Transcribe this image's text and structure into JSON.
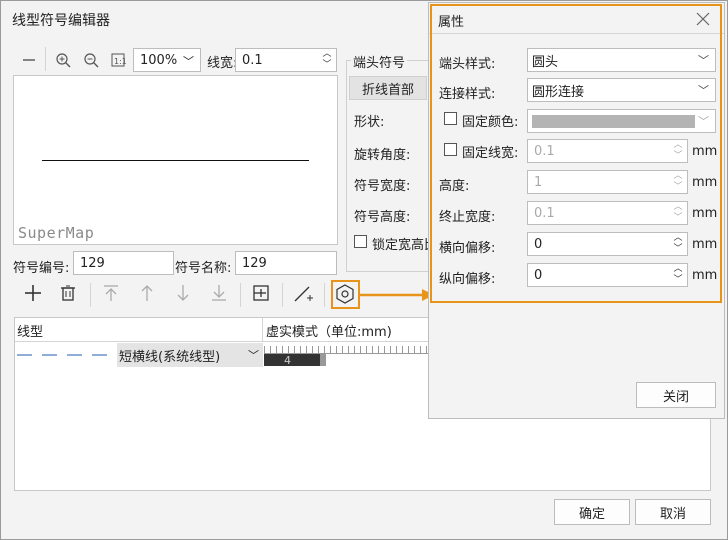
{
  "dialog": {
    "title": "线型符号编辑器",
    "toolbar": {
      "zoom_value": "100%",
      "line_width_label": "线宽:",
      "line_width_value": "0.1"
    },
    "preview_watermark": "SuperMap",
    "symbol_code_label": "符号编号:",
    "symbol_code_value": "129",
    "symbol_name_label": "符号名称:",
    "symbol_name_value": "129",
    "end_symbol_group": "端头符号",
    "end_symbol_tab": "折线首部",
    "shape_label": "形状:",
    "rotation_label": "旋转角度:",
    "symbol_width_label": "符号宽度:",
    "symbol_height_label": "符号高度:",
    "lock_ratio_label": "锁定宽高比",
    "table": {
      "col_linetype": "线型",
      "col_pattern": "虚实模式（单位:mm)",
      "row_linetype": "短横线(系统线型)",
      "row_pattern_value": "4"
    },
    "ok": "确定",
    "cancel": "取消"
  },
  "properties": {
    "title": "属性",
    "end_style_label": "端头样式:",
    "end_style_value": "圆头",
    "join_style_label": "连接样式:",
    "join_style_value": "圆形连接",
    "fixed_color_label": "固定颜色:",
    "fixed_width_label": "固定线宽:",
    "fixed_width_value": "0.1",
    "height_label": "高度:",
    "height_value": "1",
    "end_width_label": "终止宽度:",
    "end_width_value": "0.1",
    "h_offset_label": "横向偏移:",
    "h_offset_value": "0",
    "v_offset_label": "纵向偏移:",
    "v_offset_value": "0",
    "unit": "mm",
    "close": "关闭"
  },
  "colors": {
    "highlight": "#e8941a",
    "disabled_swatch": "#b4b4b4"
  }
}
